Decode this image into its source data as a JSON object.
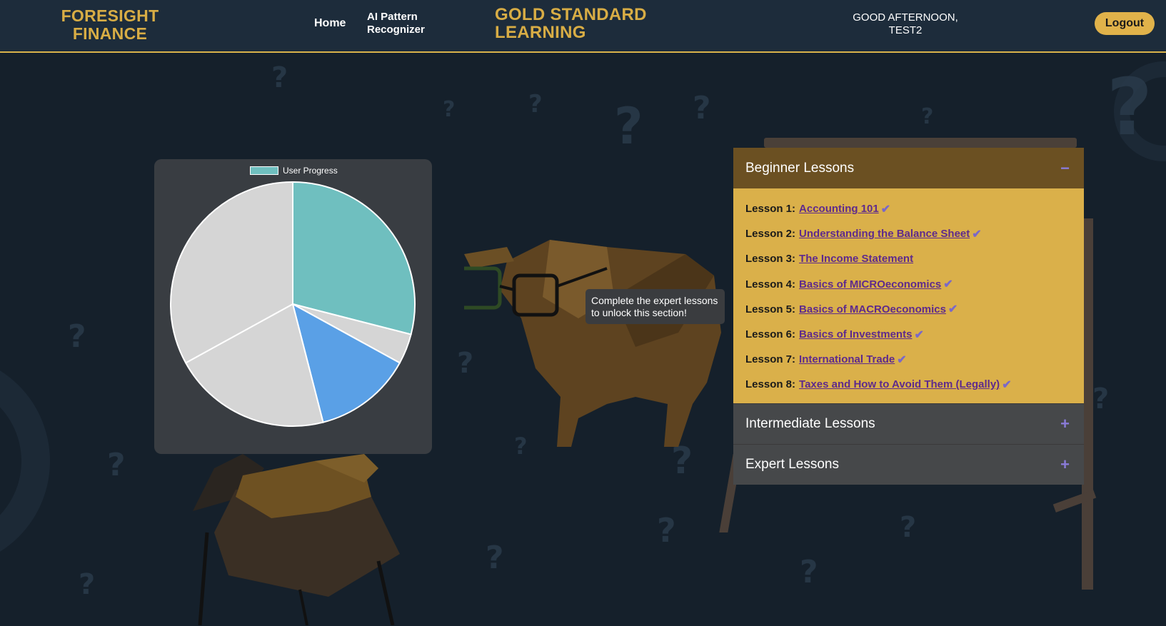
{
  "header": {
    "brand_line1": "FORESIGHT",
    "brand_line2": "FINANCE",
    "nav_home": "Home",
    "nav_ai_line1": "AI Pattern",
    "nav_ai_line2": "Recognizer",
    "title_line1": "GOLD STANDARD",
    "title_line2": "LEARNING",
    "greeting_line1": "GOOD AFTERNOON,",
    "greeting_line2": "TEST2",
    "logout_label": "Logout"
  },
  "colors": {
    "accent": "#d8ad45",
    "teal": "#6fbfbf",
    "blue": "#5aa0e6",
    "grey": "#d5d5d5",
    "background": "#15202b"
  },
  "chart_data": {
    "type": "pie",
    "legend": [
      "User Progress"
    ],
    "slices": [
      {
        "value": 29,
        "color": "#6fbfbf"
      },
      {
        "value": 4,
        "color": "#d5d5d5"
      },
      {
        "value": 13,
        "color": "#5aa0e6"
      },
      {
        "value": 21,
        "color": "#d5d5d5"
      },
      {
        "value": 33,
        "color": "#d5d5d5"
      }
    ]
  },
  "tooltip": {
    "line1": "Complete the expert lessons",
    "line2": "to unlock this section!"
  },
  "accordion": {
    "beginner_title": "Beginner Lessons",
    "beginner_toggle": "−",
    "lessons": [
      {
        "num": "Lesson 1:",
        "title": "Accounting 101",
        "done": true
      },
      {
        "num": "Lesson 2:",
        "title": "Understanding the Balance Sheet",
        "done": true
      },
      {
        "num": "Lesson 3:",
        "title": "The Income Statement",
        "done": false
      },
      {
        "num": "Lesson 4:",
        "title": "Basics of MICROeconomics",
        "done": true
      },
      {
        "num": "Lesson 5:",
        "title": "Basics of MACROeconomics",
        "done": true
      },
      {
        "num": "Lesson 6:",
        "title": "Basics of Investments",
        "done": true
      },
      {
        "num": "Lesson 7:",
        "title": "International Trade",
        "done": true
      },
      {
        "num": "Lesson 8:",
        "title": "Taxes and How to Avoid Them (Legally)",
        "done": true
      }
    ],
    "intermediate_title": "Intermediate Lessons",
    "intermediate_toggle": "+",
    "expert_title": "Expert Lessons",
    "expert_toggle": "+",
    "check_glyph": "✔"
  }
}
